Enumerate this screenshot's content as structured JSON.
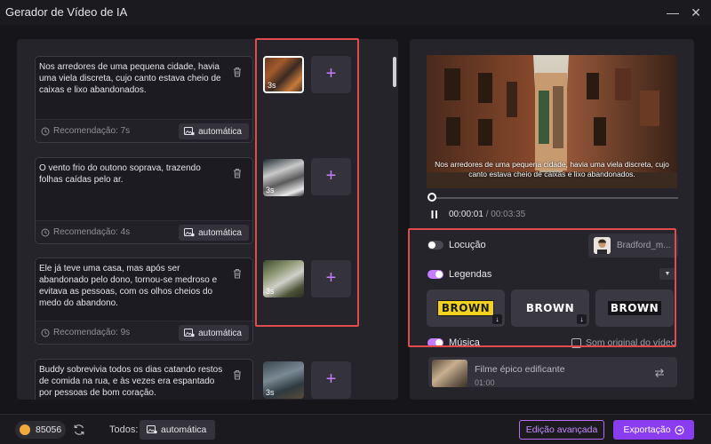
{
  "window": {
    "title": "Gerador de Vídeo de IA",
    "minimize_symbol": "—",
    "close_symbol": "✕"
  },
  "scenes": [
    {
      "text": "Nos arredores de uma pequena cidade, havia uma viela discreta, cujo canto estava cheio de caixas e lixo abandonados.",
      "recommendation": "Recomendação: 7s",
      "auto_label": "automática",
      "thumb_duration": "3s"
    },
    {
      "text": "O vento frio do outono soprava, trazendo folhas caídas pelo ar.",
      "recommendation": "Recomendação: 4s",
      "auto_label": "automática",
      "thumb_duration": "3s"
    },
    {
      "text": "Ele já teve uma casa, mas após ser abandonado pelo dono, tornou-se medroso e evitava as pessoas, com os olhos cheios do medo do abandono.",
      "recommendation": "Recomendação: 9s",
      "auto_label": "automática",
      "thumb_duration": "3s"
    },
    {
      "text": "Buddy sobrevivia todos os dias catando restos de comida na rua, e às vezes era espantado por pessoas de bom coração.",
      "thumb_duration": "3s"
    }
  ],
  "add_symbol": "+",
  "preview": {
    "subtitle": "Nos arredores de uma pequena cidade, havia uma viela discreta, cujo canto estava cheio de caixas e lixo abandonados.",
    "current_time": "00:00:01",
    "total_time": "/ 00:03:35",
    "progress": 0.005
  },
  "options": {
    "voice_label": "Locução",
    "voice_enabled": false,
    "voice_name": "Bradford_m...",
    "subtitles_label": "Legendas",
    "subtitles_enabled": true,
    "caption_styles": [
      "BROWN",
      "BROWN",
      "BROWN"
    ],
    "music_label": "Música",
    "music_enabled": true,
    "original_sound_label": "Som original do vídeo",
    "music_title": "Filme épico edificante",
    "music_duration": "01:00"
  },
  "footer": {
    "credits": "85056",
    "all_label": "Todos:",
    "auto_label": "automática",
    "advanced_button": "Edição avançada",
    "export_button": "Exportação"
  },
  "colors": {
    "accent": "#8a3df0",
    "accent_light": "#c77dff",
    "highlight_box": "#e14b4b",
    "panel": "#25242b",
    "background": "#161519"
  }
}
